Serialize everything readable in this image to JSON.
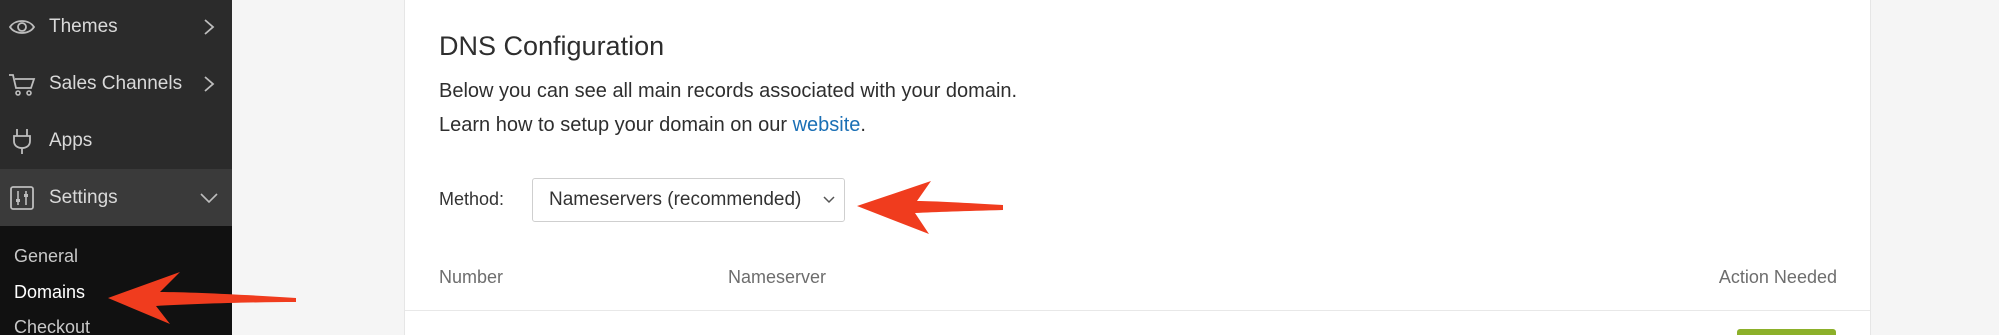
{
  "sidebar": {
    "items": [
      {
        "label": "Themes",
        "icon": "eye-icon",
        "has_chevron": "right"
      },
      {
        "label": "Sales Channels",
        "icon": "cart-icon",
        "has_chevron": "right"
      },
      {
        "label": "Apps",
        "icon": "plug-icon",
        "has_chevron": ""
      },
      {
        "label": "Settings",
        "icon": "sliders-icon",
        "has_chevron": "down"
      }
    ],
    "subitems": [
      {
        "label": "General"
      },
      {
        "label": "Domains"
      },
      {
        "label": "Checkout"
      }
    ]
  },
  "main": {
    "title": "DNS Configuration",
    "desc_line1": "Below you can see all main records associated with your domain.",
    "desc_line2_prefix": "Learn how to setup your domain on our ",
    "desc_link": "website",
    "desc_line2_suffix": ".",
    "method_label": "Method:",
    "method_value": "Nameservers (recommended)",
    "table": {
      "headers": [
        "Number",
        "Nameserver",
        "Action Needed"
      ]
    }
  },
  "colors": {
    "sidebar_bg": "#2b2b2b",
    "subnav_bg": "#111111",
    "link": "#1a6fb5",
    "annotation_arrow": "#f03c1e",
    "action_button": "#8cb02a"
  }
}
